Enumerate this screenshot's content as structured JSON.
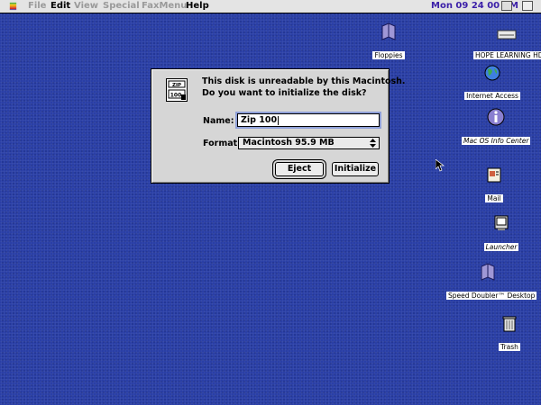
{
  "menubar": {
    "items": [
      {
        "label": "File",
        "enabled": false
      },
      {
        "label": "Edit",
        "enabled": true
      },
      {
        "label": "View",
        "enabled": false
      },
      {
        "label": "Special",
        "enabled": false
      },
      {
        "label": "FaxMenu",
        "enabled": false
      },
      {
        "label": "Help",
        "enabled": true
      }
    ],
    "clock": "Mon 09 24 00 PM"
  },
  "dialog": {
    "disk_label_top": "ZIP",
    "disk_label_bottom": "100",
    "message_line1": "This disk is unreadable by this Macintosh.",
    "message_line2": "Do you want to initialize the disk?",
    "name_label": "Name:",
    "name_value": "Zip 100",
    "format_label": "Format:",
    "format_value": "Macintosh 95.9 MB",
    "eject_label": "Eject",
    "initialize_label": "Initialize"
  },
  "desktop_icons": {
    "floppies": "Floppies",
    "hard_disk": "HOPE LEARNING HD",
    "internet_access": "Internet Access",
    "info_center": "Mac OS Info Center",
    "mail": "Mail",
    "launcher": "Launcher",
    "speed_doubler": "Speed Doubler™ Desktop",
    "trash": "Trash"
  },
  "colors": {
    "desktop": "#2a3fa6",
    "clock_text": "#3b1fa8",
    "folder": "#9f97d6"
  }
}
